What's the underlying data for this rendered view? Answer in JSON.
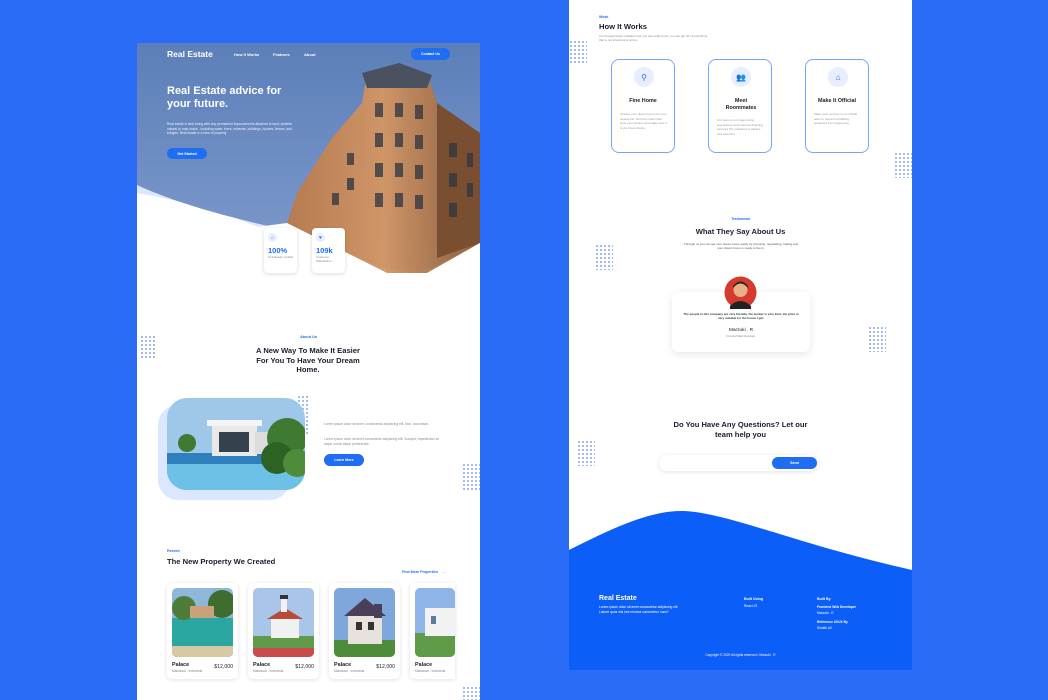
{
  "colors": {
    "background": "#2b6cf6",
    "accent": "#1f6df2",
    "hero_overlay": "#6d8dc0",
    "footer": "#0b5ef7"
  },
  "left": {
    "brand": "Real Estate",
    "nav": [
      "How It Works",
      "Features",
      "About"
    ],
    "contact_button": "Contact Us",
    "hero": {
      "title": "Real Estate advice for your future.",
      "description": "Real estate is land along with any permanent improvements attached to land, whether natural or man-made - including water, trees, minerals, buildings, houses, fences, and bridges. Real estate is a form of property",
      "cta": "Get Started"
    },
    "stats": [
      {
        "icon": "home-icon",
        "value": "100%",
        "label": "Unit Ready Livable"
      },
      {
        "icon": "heart-icon",
        "value": "109k",
        "label": "Customer Satisfaction"
      }
    ],
    "about": {
      "tag": "About Us",
      "title": "A New Way To Make It Easier For You To Have Your Dream Home.",
      "para1": "Lorem ipsum dolor sit amet, consectetur adipiscing elit. Non, accumsan.",
      "para2": "Lorem ipsum dolor sit amet consectetur adipiscing elit. Suscipit, repellendus sit atque omnis atque perferendis.",
      "cta": "Learn More"
    },
    "recent": {
      "tag": "Recent",
      "title": "The New Property We Created",
      "link": "Find More Properties",
      "arrow": "→",
      "cards": [
        {
          "name": "Palace",
          "location": "Makassar , Indonesia",
          "price": "$12,000"
        },
        {
          "name": "Palace",
          "location": "Makassar , Indonesia",
          "price": "$12,000"
        },
        {
          "name": "Palace",
          "location": "Makassar , Indonesia",
          "price": "$12,000"
        },
        {
          "name": "Palace",
          "location": "Makassar , Indonesia",
          "price": ""
        }
      ]
    }
  },
  "right": {
    "work": {
      "tag": "Work",
      "title": "How It Works",
      "description": "It is through those mistakes that you can really grow, you can get rid of everything that is not important to arrive.",
      "cards": [
        {
          "icon": "search-icon",
          "title": "Fine Home",
          "description": "Choose your dream home from our diverse list. Find the option that suits your dreams and make sure it is your best choice."
        },
        {
          "icon": "users-icon",
          "title": "Meet Roommates",
          "description": "Our team is no longer doing preparatory work such as directing services this residence is always well cared for."
        },
        {
          "icon": "house-check-icon",
          "title": "Make It Official",
          "description": "Make sure you buy in our official team to prevent unfulfilling unwanted from happening."
        }
      ]
    },
    "testimonial": {
      "tag": "Testimonial",
      "title": "What They Say About Us",
      "description": "Through us you can get your dream home easily by choosing, negotiating, trading and your dream home is ready to live in.",
      "quote": "The people in this company are very friendly, the worker is very kind, the price is very suitable for the house I get.",
      "name": "Marzuki . R",
      "role": "Frontend Web Developer"
    },
    "questions": {
      "title": "Do You Have Any Questions? Let our team help you",
      "input_placeholder": "",
      "send": "Send"
    },
    "footer": {
      "brand": "Real Estate",
      "description": "Lorem ipsum dolor sit amet consectetur adipiscing elit. Labore quos nisi iure minima consectetur iusm?",
      "col1_title": "Built Using",
      "col1_item": "React JS",
      "col2_title": "Built By",
      "col2_item1_title": "Frontend Web Developer",
      "col2_item1": "Marzuki . R",
      "col2_item2_title": "Reference UI/UX By",
      "col2_item2": "Shakib Ali",
      "copyright": "Copyright © 2020 All rights reserved • Marzuki . R"
    }
  }
}
